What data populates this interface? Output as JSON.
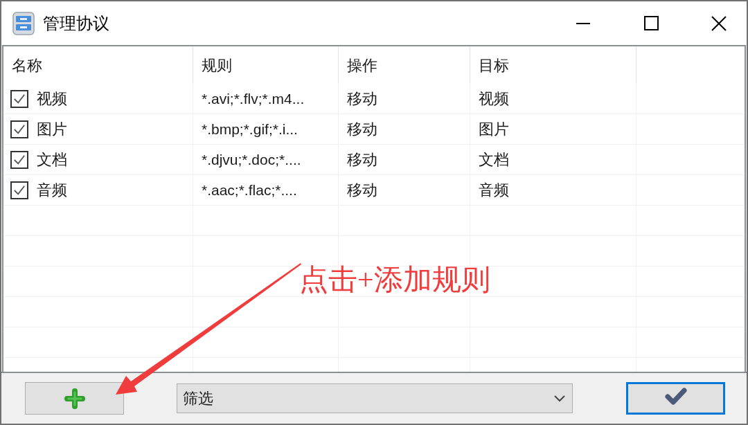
{
  "window": {
    "title": "管理协议"
  },
  "table": {
    "columns": [
      "名称",
      "规则",
      "操作",
      "目标"
    ],
    "rows": [
      {
        "checked": true,
        "name": "视频",
        "rule": "*.avi;*.flv;*.m4...",
        "action": "移动",
        "target": "视频"
      },
      {
        "checked": true,
        "name": "图片",
        "rule": "*.bmp;*.gif;*.i...",
        "action": "移动",
        "target": "图片"
      },
      {
        "checked": true,
        "name": "文档",
        "rule": "*.djvu;*.doc;*....",
        "action": "移动",
        "target": "文档"
      },
      {
        "checked": true,
        "name": "音频",
        "rule": "*.aac;*.flac;*....",
        "action": "移动",
        "target": "音频"
      }
    ]
  },
  "bottom_bar": {
    "add_button": {
      "focused": false
    },
    "filter": {
      "value": "筛选"
    },
    "ok_button": {
      "focused": true
    }
  },
  "annotation": {
    "text": "点击+添加规则"
  }
}
